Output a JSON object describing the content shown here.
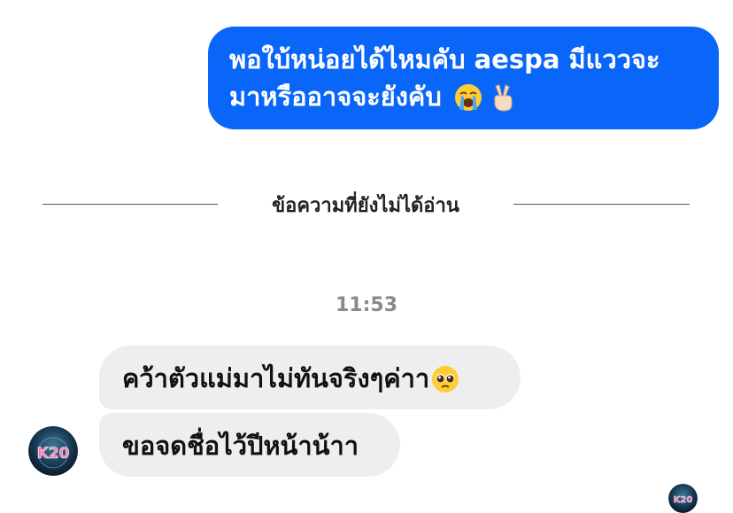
{
  "messages": {
    "outgoing": {
      "line1": "พอใบ้หน่อยได้ไหมคับ aespa มีแววจะ",
      "line2": "มาหรืออาจจะยังคับ",
      "emojis": [
        "loudly-crying-face-icon",
        "victory-hand-icon"
      ]
    },
    "divider_label": "ข้อความที่ยังไม่ได้อ่าน",
    "timestamp": "11:53",
    "incoming": [
      {
        "text": "คว้าตัวแม่มาไม่ทันจริงๆค่าา",
        "emoji": "pleading-face-icon"
      },
      {
        "text": "ขอจดชื่อไว้ปีหน้าน้าา"
      }
    ],
    "avatar_label": "K20"
  },
  "colors": {
    "outgoing_bubble": "#0a66f8",
    "incoming_bubble": "#eeeef0",
    "timestamp": "#8a8a8e",
    "divider": "#555555"
  }
}
